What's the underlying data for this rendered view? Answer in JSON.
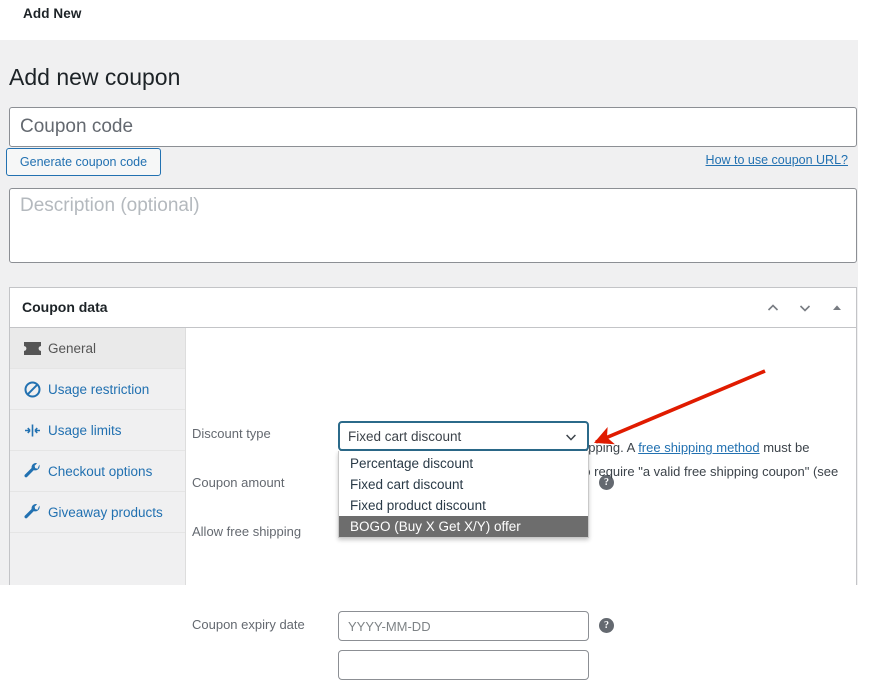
{
  "topbar": {
    "add_new_label": "Add New"
  },
  "page": {
    "title": "Add new coupon"
  },
  "coupon_code": {
    "placeholder": "Coupon code",
    "value": "",
    "generate_button": "Generate coupon code",
    "url_help_link": "How to use coupon URL?"
  },
  "description": {
    "placeholder": "Description (optional)",
    "value": ""
  },
  "coupon_data": {
    "panel_title": "Coupon data",
    "header_icons": [
      "chevron-up-icon",
      "chevron-down-icon",
      "toggle-triangle-icon"
    ],
    "tabs": [
      {
        "label": "General",
        "icon": "ticket-icon",
        "active": true
      },
      {
        "label": "Usage restriction",
        "icon": "blocked-icon",
        "active": false
      },
      {
        "label": "Usage limits",
        "icon": "limits-icon",
        "active": false
      },
      {
        "label": "Checkout options",
        "icon": "wrench-icon",
        "active": false
      },
      {
        "label": "Giveaway products",
        "icon": "wrench-icon",
        "active": false
      }
    ],
    "fields": {
      "discount_type_label": "Discount type",
      "discount_type_value": "Fixed cart discount",
      "discount_type_options": [
        "Percentage discount",
        "Fixed cart discount",
        "Fixed product discount",
        "BOGO (Buy X Get X/Y) offer"
      ],
      "discount_type_highlighted": "BOGO (Buy X Get X/Y) offer",
      "coupon_amount_label": "Coupon amount",
      "coupon_amount_value": "",
      "allow_free_shipping_label": "Allow free shipping",
      "free_shipping_desc_part1": "Check this box if the coupon grants free shipping. A ",
      "free_shipping_link": "free shipping method",
      "free_shipping_desc_part2": " must be enabled in your shipping zone and be set to require \"a valid free shipping coupon\" (see the \"Free Shipping Requires\" setting).",
      "coupon_expiry_label": "Coupon expiry date",
      "coupon_expiry_placeholder": "YYYY-MM-DD",
      "coupon_expiry_value": "",
      "help_icon": "question-mark-icon"
    }
  },
  "annotation": {
    "arrow": "red-arrow-pointer",
    "color": "#e01b00"
  },
  "colors": {
    "link": "#2271b1",
    "page_bg": "#f0f0f1",
    "panel_bg": "#ffffff",
    "border": "#c3c4c7",
    "select_focus_border": "#2b6a8a",
    "option_highlight": "#6d6d6d",
    "arrow_red": "#e01b00"
  }
}
